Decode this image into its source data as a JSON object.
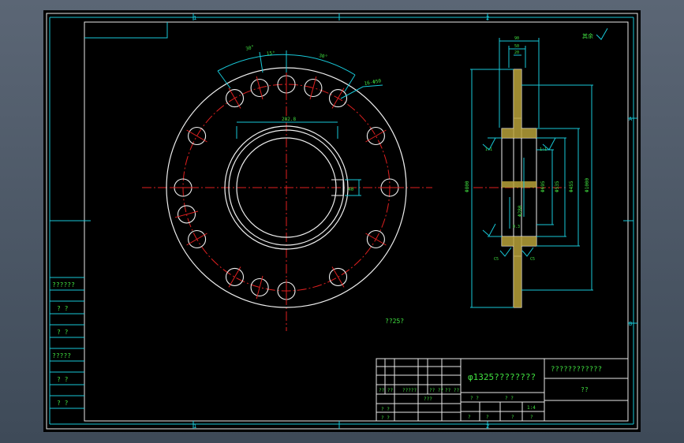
{
  "drawing": {
    "zone_labels_top": [
      "1",
      "2"
    ],
    "zone_labels_bottom": [
      "1",
      "2"
    ],
    "zone_labels_side": [
      "A",
      "B"
    ],
    "note": "??25?",
    "face_view": {
      "angle_dims": [
        "30°",
        "15°",
        "30°"
      ],
      "hole_callout": "16-Φ50",
      "keyway_dim": "282.8",
      "key_width": "40"
    },
    "section_view": {
      "dims_top": [
        "90",
        "50",
        "20"
      ],
      "surface_finish": "其余",
      "diameters": [
        "Φ800",
        "Φ695",
        "Φ535",
        "Φ455",
        "Φ280",
        "Φ1000"
      ],
      "small_labels": [
        "1:1",
        "1:1",
        "0.3",
        "C5",
        "C5"
      ]
    }
  },
  "left_panel": {
    "rows": [
      "??????",
      "? ?",
      "? ?",
      "?????",
      "? ?",
      "? ?"
    ]
  },
  "title_block": {
    "part_name": "φ1325????????",
    "company": "????????????",
    "material": "??",
    "row_labels": [
      "?? ??",
      "?????",
      "?? ??",
      "?? ??"
    ],
    "sign_labels": [
      "? ?",
      "? ?",
      "???"
    ],
    "scale_row": [
      "? ?",
      "? ?",
      "1:4"
    ],
    "sheet_row": [
      "?",
      "?",
      "?",
      "?"
    ]
  }
}
